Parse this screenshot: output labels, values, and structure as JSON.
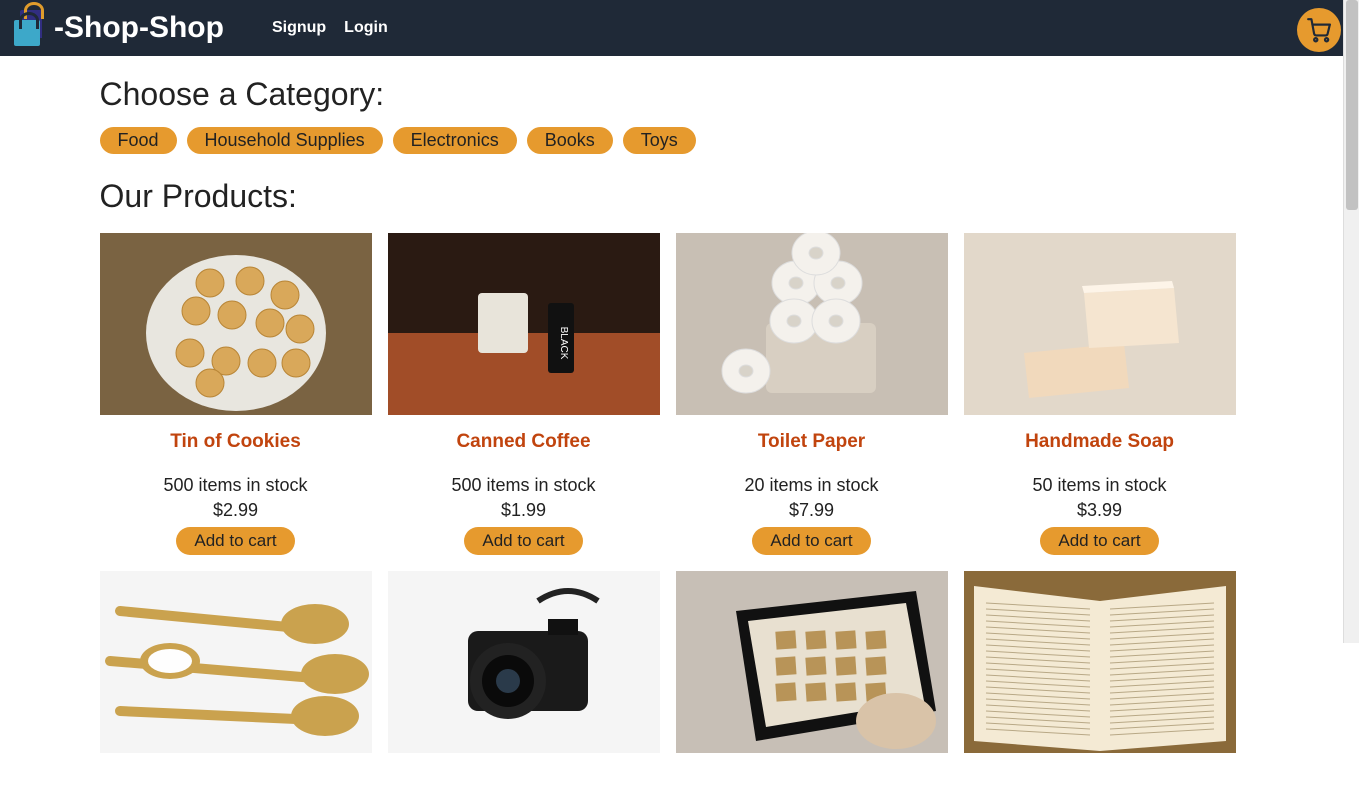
{
  "header": {
    "brand": "-Shop-Shop",
    "links": {
      "signup": "Signup",
      "login": "Login"
    }
  },
  "headings": {
    "category": "Choose a Category:",
    "products": "Our Products:"
  },
  "categories": [
    "Food",
    "Household Supplies",
    "Electronics",
    "Books",
    "Toys"
  ],
  "products": [
    {
      "name": "Tin of Cookies",
      "stock": "500 items in stock",
      "price": "$2.99",
      "add": "Add to cart",
      "img": "img-cookies"
    },
    {
      "name": "Canned Coffee",
      "stock": "500 items in stock",
      "price": "$1.99",
      "add": "Add to cart",
      "img": "img-coffee"
    },
    {
      "name": "Toilet Paper",
      "stock": "20 items in stock",
      "price": "$7.99",
      "add": "Add to cart",
      "img": "img-toilet"
    },
    {
      "name": "Handmade Soap",
      "stock": "50 items in stock",
      "price": "$3.99",
      "add": "Add to cart",
      "img": "img-soap"
    },
    {
      "name": "",
      "stock": "",
      "price": "",
      "add": "",
      "img": "img-spices"
    },
    {
      "name": "",
      "stock": "",
      "price": "",
      "add": "",
      "img": "img-camera"
    },
    {
      "name": "",
      "stock": "",
      "price": "",
      "add": "",
      "img": "img-tablet"
    },
    {
      "name": "",
      "stock": "",
      "price": "",
      "add": "",
      "img": "img-book"
    }
  ]
}
